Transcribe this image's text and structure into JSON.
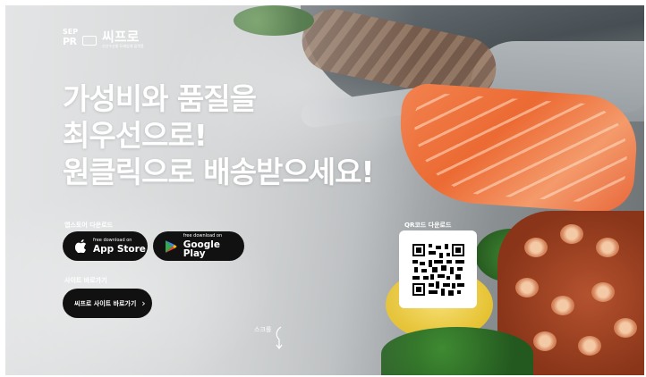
{
  "brand": {
    "mark_top": "SEP",
    "mark_bottom": "PR",
    "name": "씨프로",
    "tagline": "신선수산물 도매업체 플랫폼"
  },
  "headline": {
    "line1": "가성비와 품질을",
    "line2": "최우선으로!",
    "line3": "원클릭으로 배송받으세요!"
  },
  "app_download": {
    "label": "앱스토어 다운로드",
    "app_store": {
      "small": "free download on",
      "big": "App Store",
      "icon": "apple-icon"
    },
    "google_play": {
      "small": "free download on",
      "big": "Google Play",
      "icon": "google-play-icon"
    }
  },
  "site": {
    "label": "사이트 바로가기",
    "button": "씨프로 사이트 바로가기",
    "arrow": "›"
  },
  "qr": {
    "label": "QR코드 다운로드"
  },
  "scroll_hint": "스크롤",
  "colors": {
    "button_bg": "#111111",
    "text": "#ffffff",
    "salmon": "#ec6a33"
  }
}
